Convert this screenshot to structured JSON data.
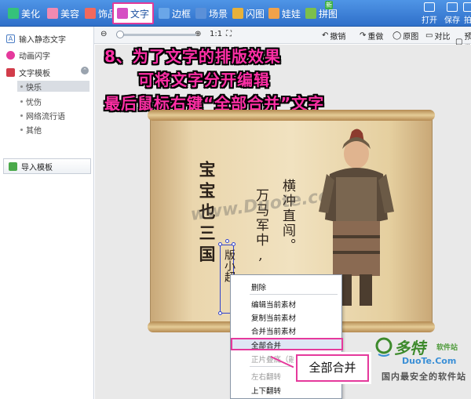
{
  "toolbar": {
    "tabs": [
      {
        "label": "美化",
        "color": "#35c27a"
      },
      {
        "label": "美容",
        "color": "#f08ab1"
      },
      {
        "label": "饰品",
        "color": "#f2695c"
      },
      {
        "label": "文字",
        "color": "#d64fc3"
      },
      {
        "label": "边框",
        "color": "#6aa6e8"
      },
      {
        "label": "场景",
        "color": "#5b90d8"
      },
      {
        "label": "闪图",
        "color": "#e8b13a"
      },
      {
        "label": "娃娃",
        "color": "#f0a24a"
      },
      {
        "label": "拼图",
        "color": "#7cbf4b"
      }
    ],
    "new_badge": "新",
    "right": {
      "open": "打开",
      "save": "保存",
      "extra": "拍"
    }
  },
  "sidebar": {
    "items": [
      {
        "label": "输入静态文字",
        "icon": "text-a-icon"
      },
      {
        "label": "动画闪字",
        "icon": "sparkle-icon"
      },
      {
        "label": "文字模板",
        "icon": "love-template-icon"
      }
    ],
    "sub_items": [
      "快乐",
      "忧伤",
      "网络流行语",
      "其他"
    ],
    "import_label": "导入模板"
  },
  "toolbar2": {
    "zoom_1to1": "1:1",
    "undo": "撤销",
    "redo": "重做",
    "original": "原图",
    "compare": "对比",
    "preview": "预览"
  },
  "annotation": {
    "line1": "8、为了文字的排版效果",
    "line2": "可将文字分开编辑",
    "line3": "最后鼠标右键“全部合并”文字"
  },
  "poem": {
    "col1": "宝宝也三国",
    "col2": "万马军中,",
    "col3": "横冲直闯。",
    "col4": "版小超"
  },
  "watermark": "www.Duote.com",
  "context_menu": {
    "items": [
      "删除",
      "编辑当前素材",
      "复制当前素材",
      "合并当前素材",
      "全部合并",
      "正片叠底（融",
      "左右翻转",
      "上下翻转"
    ]
  },
  "callout": "全部合并",
  "logo": {
    "brand": "多特",
    "sub": "软件站",
    "url": "DuoTe.Com",
    "tagline": "国内最安全的软件站"
  }
}
